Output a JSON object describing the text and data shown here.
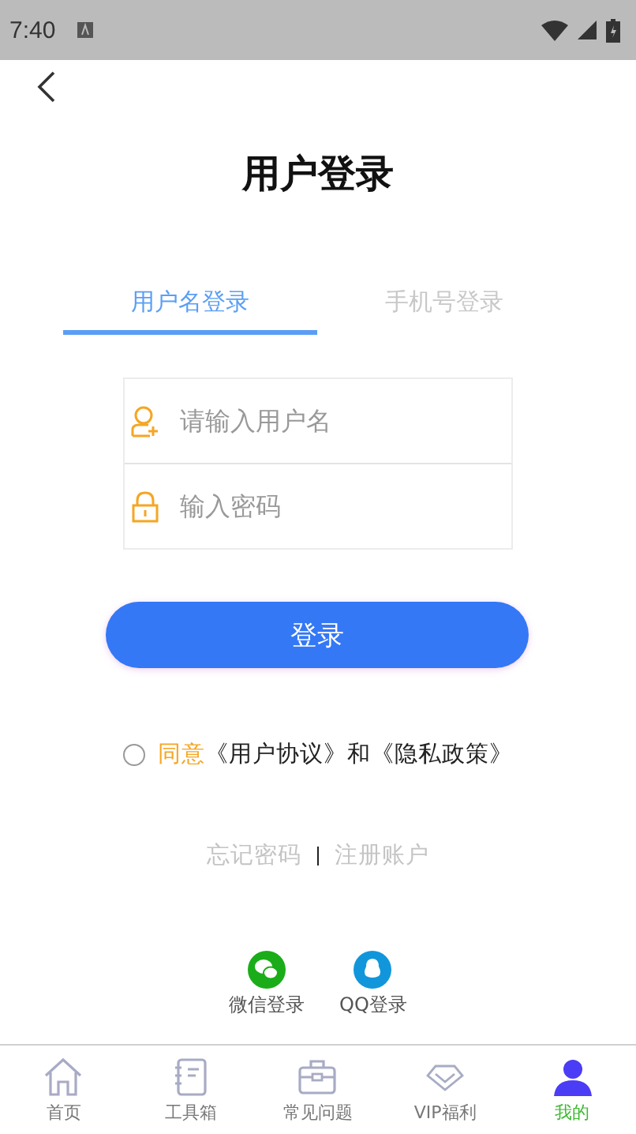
{
  "status_bar": {
    "time": "7:40"
  },
  "title": "用户登录",
  "tabs": [
    {
      "label": "用户名登录",
      "selected": true
    },
    {
      "label": "手机号登录",
      "selected": false
    }
  ],
  "fields": [
    {
      "kind": "user",
      "placeholder": "请输入用户名"
    },
    {
      "kind": "lock",
      "placeholder": "输入密码"
    }
  ],
  "login_button": "登录",
  "agreement": {
    "checked": false,
    "agree": "同意",
    "text": "《用户协议》和《隐私政策》"
  },
  "links": [
    "忘记密码",
    "注册账户"
  ],
  "social": [
    {
      "kind": "wechat",
      "label": "微信登录"
    },
    {
      "kind": "qq",
      "label": "QQ登录"
    }
  ],
  "nav": [
    {
      "kind": "home",
      "label": "首页",
      "selected": false
    },
    {
      "kind": "notebook",
      "label": "工具箱",
      "selected": false
    },
    {
      "kind": "briefcase",
      "label": "常见问题",
      "selected": false
    },
    {
      "kind": "diamond",
      "label": "VIP福利",
      "selected": false
    },
    {
      "kind": "person",
      "label": "我的",
      "selected": true
    }
  ]
}
